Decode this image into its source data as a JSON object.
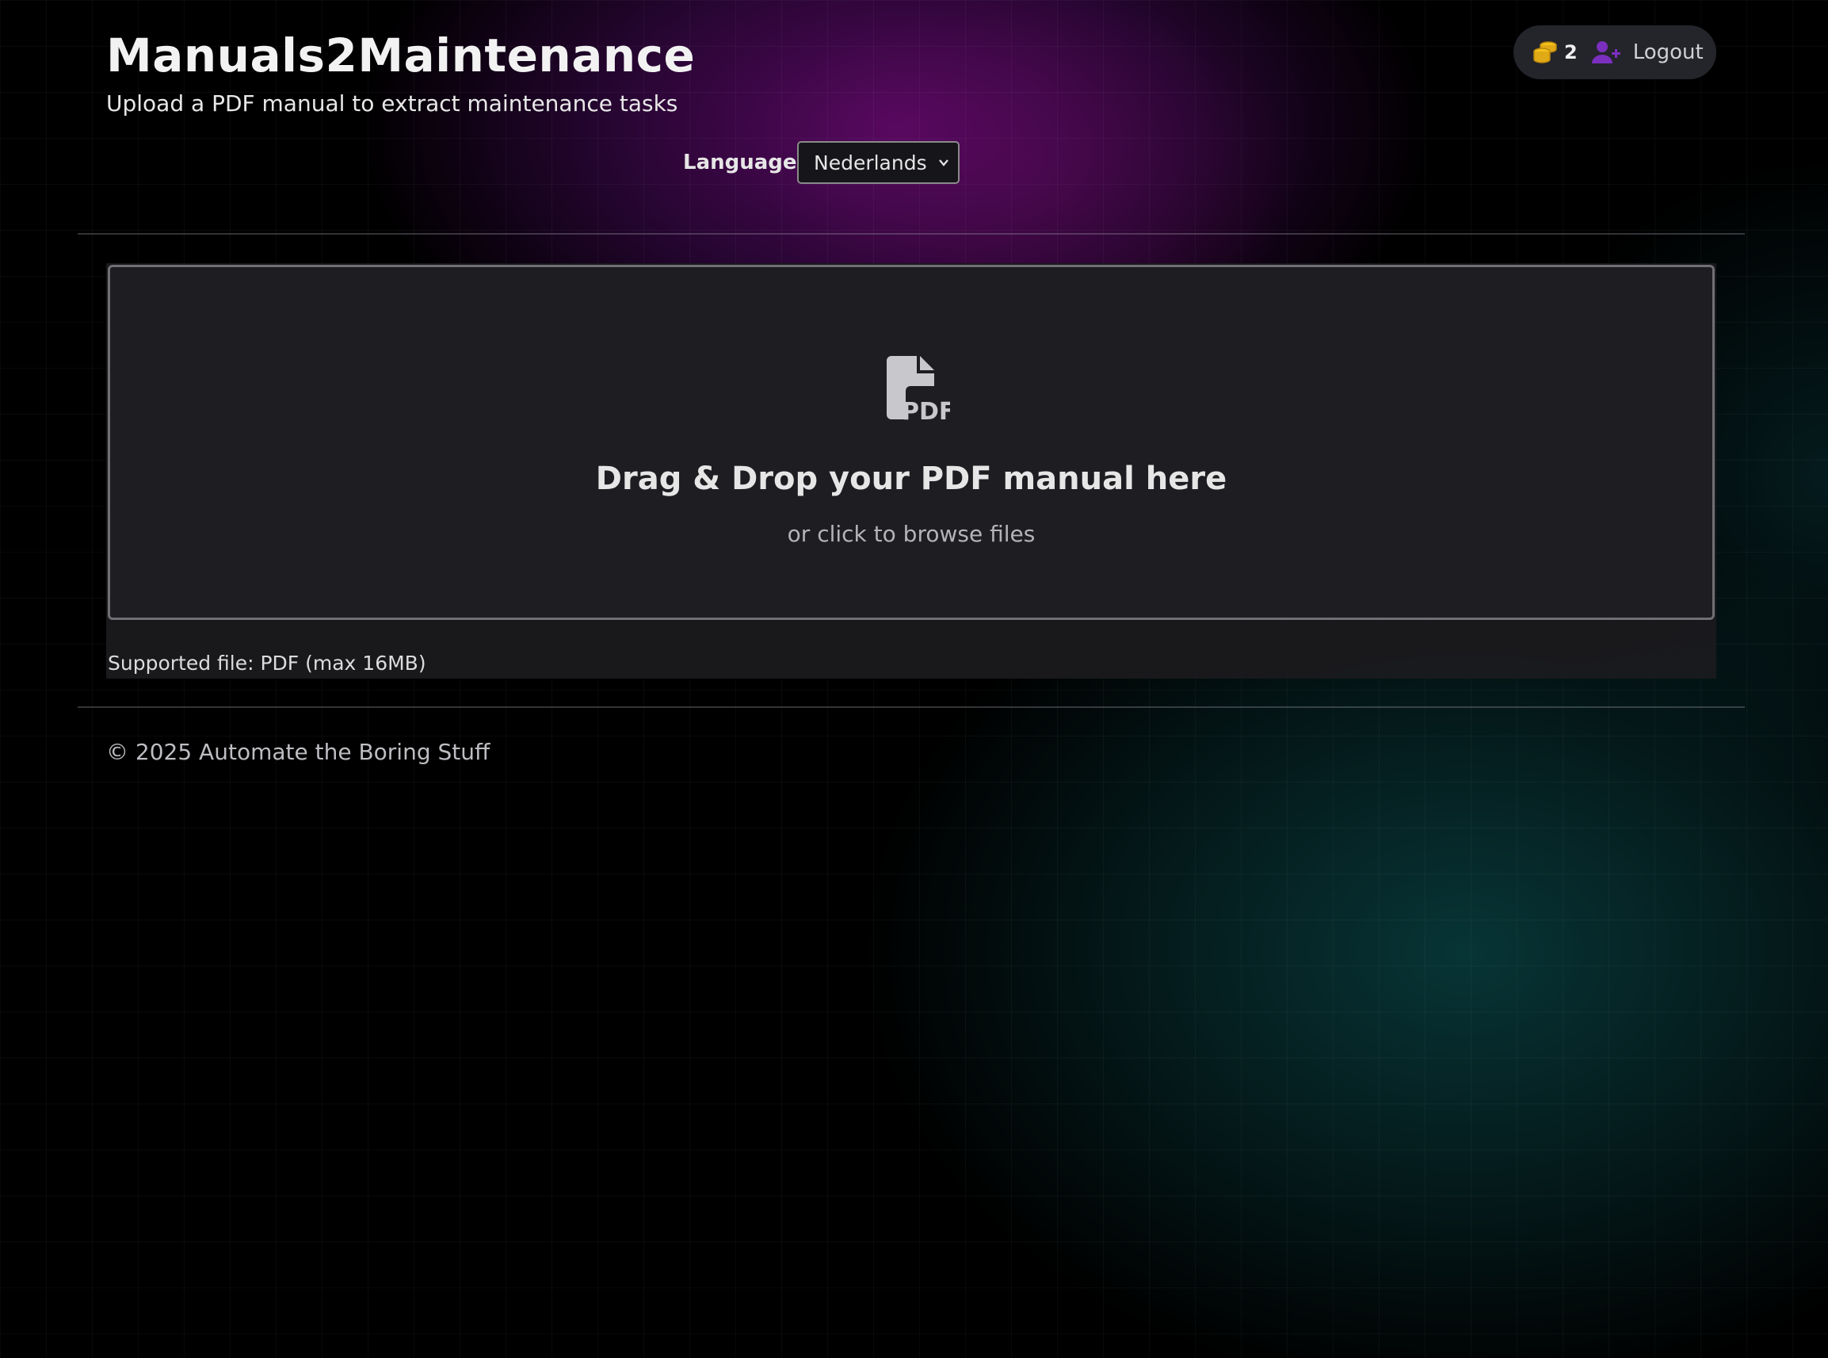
{
  "header": {
    "title": "Manuals2Maintenance",
    "subtitle": "Upload a PDF manual to extract maintenance tasks"
  },
  "user": {
    "credits": "2",
    "credits_icon": "coins-icon",
    "logout_icon": "user-plus-icon",
    "logout_label": "Logout"
  },
  "language": {
    "label": "Language:",
    "selected": "Nederlands"
  },
  "upload": {
    "icon": "pdf-file-icon",
    "title": "Drag & Drop your PDF manual here",
    "subtitle": "or click to browse files",
    "supported": "Supported file: PDF (max 16MB)"
  },
  "footer": {
    "copyright": "© 2025 Automate the Boring Stuff"
  },
  "colors": {
    "accent_purple": "#7b2fbf",
    "coin_gold": "#e8b81c",
    "background": "#000000"
  }
}
